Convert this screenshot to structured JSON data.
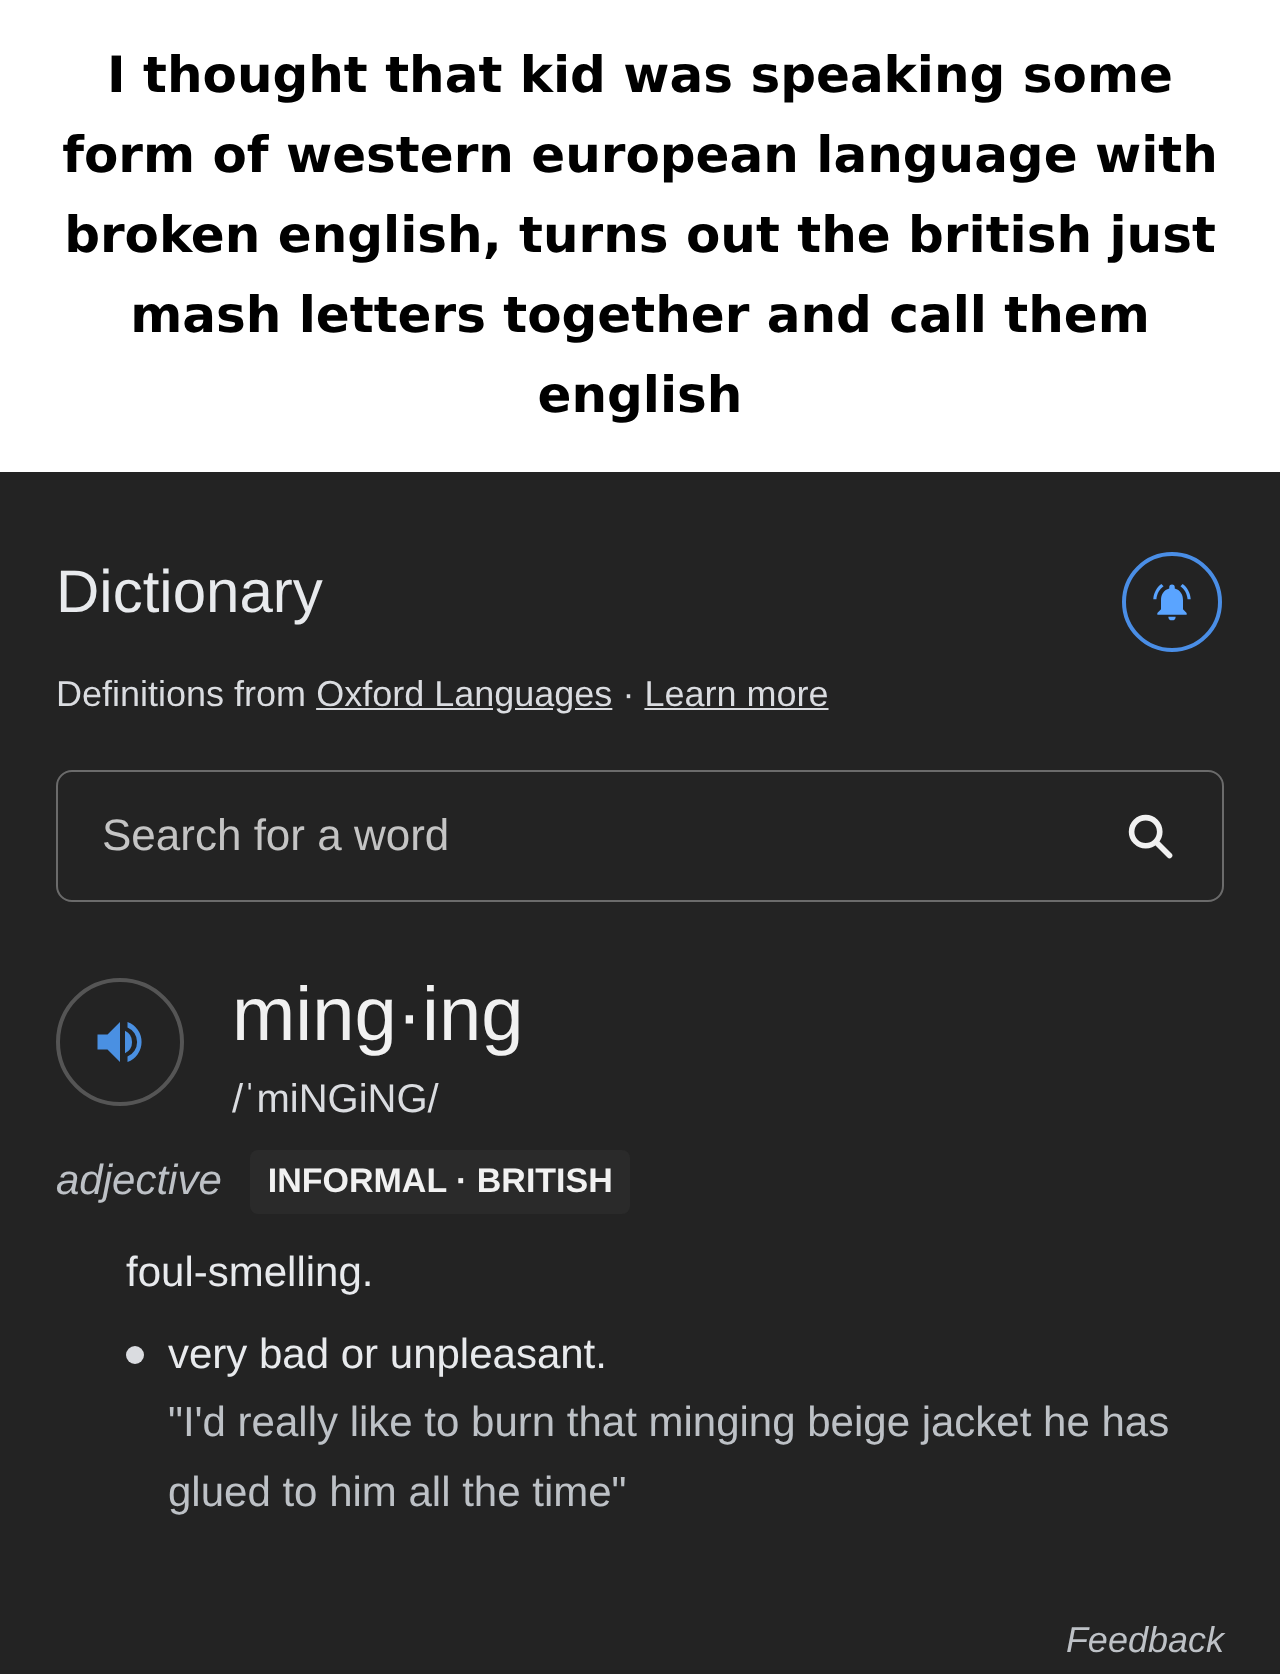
{
  "caption": "I thought that kid was speaking some form of western european language with broken english, turns out the british just mash letters together and call them english",
  "header": {
    "title": "Dictionary",
    "source_prefix": "Definitions from",
    "source_link": "Oxford Languages",
    "separator": "·",
    "learn_more": "Learn more"
  },
  "search": {
    "placeholder": "Search for a word"
  },
  "entry": {
    "word": "ming·ing",
    "pronunciation": "/ˈmiNGiNG/",
    "part_of_speech": "adjective",
    "labels": "INFORMAL · BRITISH",
    "definitions": [
      {
        "kind": "plain",
        "text": "foul-smelling."
      },
      {
        "kind": "bullet",
        "text": "very bad or unpleasant.",
        "example": "\"I'd really like to burn that minging beige jacket he has glued to him all the time\""
      }
    ]
  },
  "feedback": "Feedback"
}
